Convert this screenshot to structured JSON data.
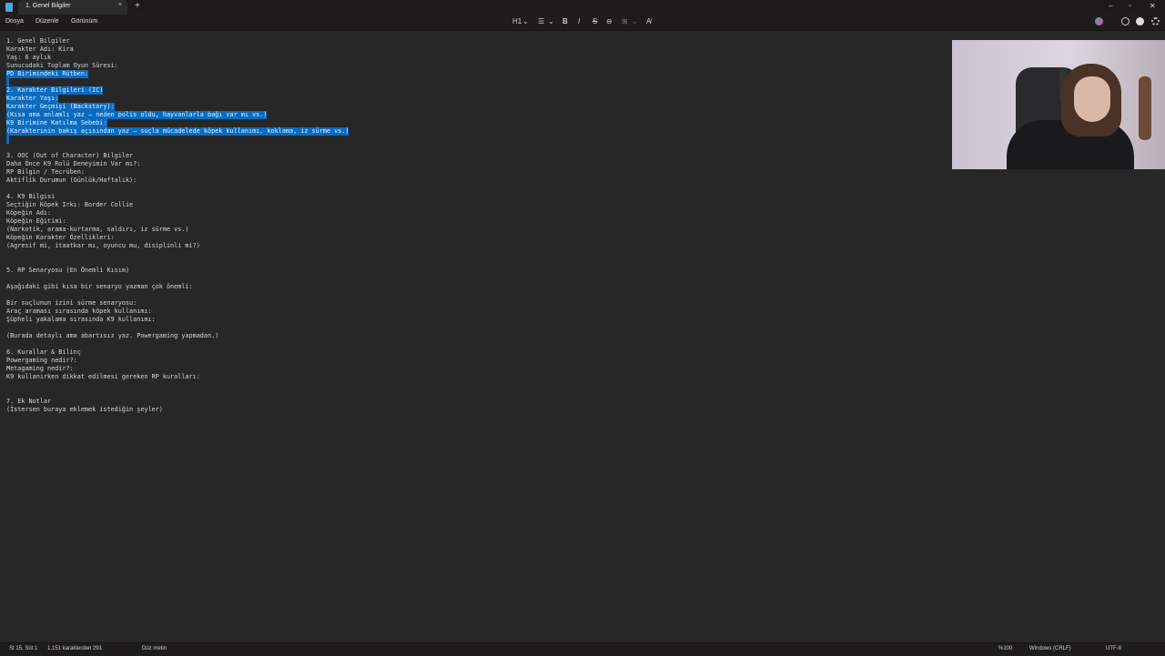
{
  "window": {
    "tab_title": "1. Genel Bilgiler",
    "tab_close": "×",
    "new_tab": "+",
    "minimize": "–",
    "maximize": "▫",
    "close": "✕"
  },
  "menu": {
    "file": "Dosya",
    "edit": "Düzenle",
    "view": "Görünüm"
  },
  "toolbar": {
    "heading": "H1",
    "heading_arrow": "⌄",
    "list": "☰",
    "list_arrow": "⌄",
    "bold": "B",
    "italic": "I",
    "strike": "S",
    "link": "⊖",
    "table": "⊞",
    "table_arrow": "⌄",
    "clear": "A̸"
  },
  "editor": {
    "lines": [
      "1. Genel Bilgiler",
      "Karakter Adı: Kira",
      "Yaş: 6 aylık",
      "Sunucudaki Toplam Oyun Süresi:",
      "PD Birimindeki Rütben:",
      "",
      "2. Karakter Bilgileri (IC)",
      "Karakter Yaşı:",
      "Karakter Geçmişi (Backstory):",
      "(Kısa ama anlamlı yaz – neden polis oldu, hayvanlarla bağı var mı vs.)",
      "K9 Birimine Katılma Sebebi:",
      "(Karakterinin bakış açısından yaz – suçla mücadelede köpek kullanımı, koklama, iz sürme vs.)",
      "",
      "",
      "3. OOC (Out of Character) Bilgiler",
      "Daha Önce K9 Rolü Deneyimin Var mı?:",
      "RP Bilgin / Tecrüben:",
      "Aktiflik Durumun (Günlük/Haftalık):",
      "",
      "4. K9 Bilgisi",
      "Seçtiğin Köpek Irkı: Border Collie",
      "Köpeğin Adı:",
      "Köpeğin Eğitimi:",
      "(Narkotik, arama-kurtarma, saldırı, iz sürme vs.)",
      "Köpeğin Karakter Özellikleri:",
      "(Agresif mi, itaatkar mı, oyuncu mu, disiplinli mi?)",
      "",
      "",
      "5. RP Senaryosu (En Önemli Kısım)",
      "",
      "Aşağıdaki gibi kısa bir senaryo yazman çok önemli:",
      "",
      "Bir suçlunun izini sürme senaryosu:",
      "Araç araması sırasında köpek kullanımı:",
      "Şüpheli yakalama sırasında K9 kullanımı:",
      "",
      "(Burada detaylı ama abartısız yaz. Powergaming yapmadan.)",
      "",
      "6. Kurallar & Bilinç",
      "Powergaming nedir?:",
      "Metagaming nedir?:",
      "K9 kullanırken dikkat edilmesi gereken RP kuralları:",
      "",
      "",
      "7. Ek Notlar",
      "(İstersen buraya eklemek istediğin şeyler)"
    ]
  },
  "status": {
    "position": "St 15, Süt 1",
    "chars": "1.151 karakterden 291",
    "format": "Düz metin",
    "zoom": "%100",
    "line_ending": "Windows (CRLF)",
    "encoding": "UTF-8"
  }
}
